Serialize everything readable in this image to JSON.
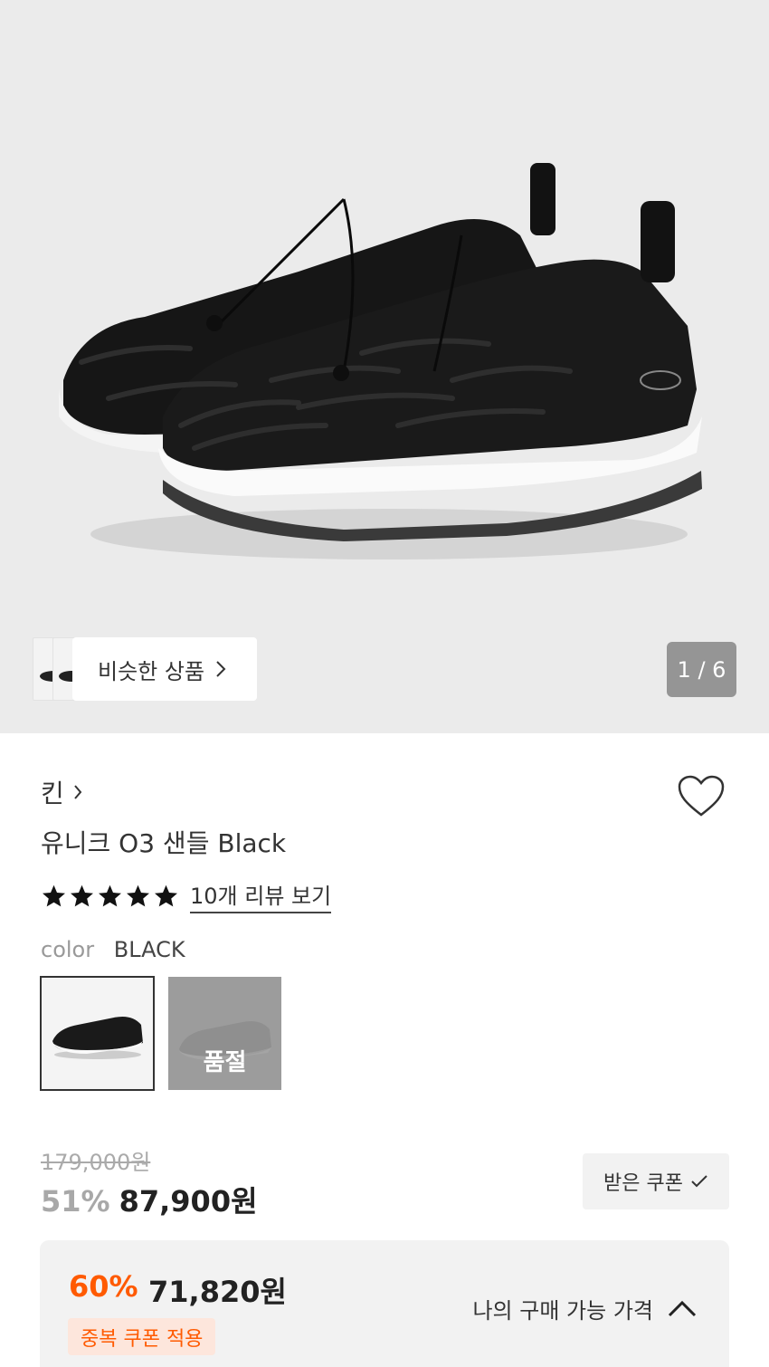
{
  "gallery": {
    "similar_label": "비슷한 상품",
    "pager": "1 / 6"
  },
  "product": {
    "brand": "킨",
    "title": "유니크 O3 샌들 Black",
    "rating_stars": 5,
    "review_link": "10개 리뷰 보기",
    "color_label": "color",
    "color_value": "BLACK",
    "soldout_label": "품절"
  },
  "price": {
    "original": "179,000원",
    "discount_rate": "51%",
    "sale": "87,900원",
    "coupon_button": "받은 쿠폰"
  },
  "best_price": {
    "rate": "60%",
    "price": "71,820원",
    "badge": "중복 쿠폰 적용",
    "toggle_label": "나의 구매 가능 가격"
  },
  "colors": {
    "discount_accent": "#ff5a00",
    "hero_bg": "#ebebeb"
  }
}
